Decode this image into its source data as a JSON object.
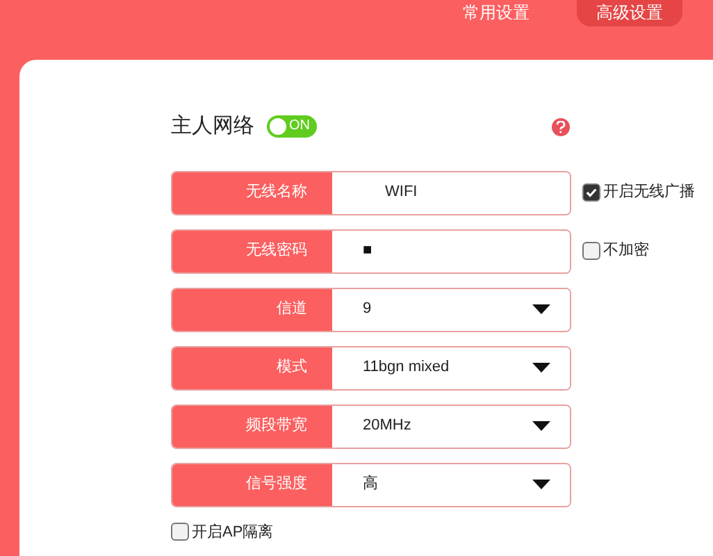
{
  "tabs": [
    {
      "label": "常用设置",
      "selected": false
    },
    {
      "label": "高级设置",
      "selected": true
    }
  ],
  "network": {
    "title": "主人网络",
    "toggle": {
      "on": true,
      "label": "ON"
    }
  },
  "fields": [
    {
      "kind": "text",
      "label": "无线名称",
      "value": "WIFI",
      "option": {
        "label": "开启无线广播",
        "checked": true
      }
    },
    {
      "kind": "password",
      "label": "无线密码",
      "value": "■",
      "option": {
        "label": "不加密",
        "checked": false
      }
    },
    {
      "kind": "select",
      "label": "信道",
      "value": "9"
    },
    {
      "kind": "select",
      "label": "模式",
      "value": "11bgn mixed"
    },
    {
      "kind": "select",
      "label": "频段带宽",
      "value": "20MHz"
    },
    {
      "kind": "select",
      "label": "信号强度",
      "value": "高"
    }
  ],
  "ap_isolation": {
    "label": "开启AP隔离",
    "checked": false
  }
}
